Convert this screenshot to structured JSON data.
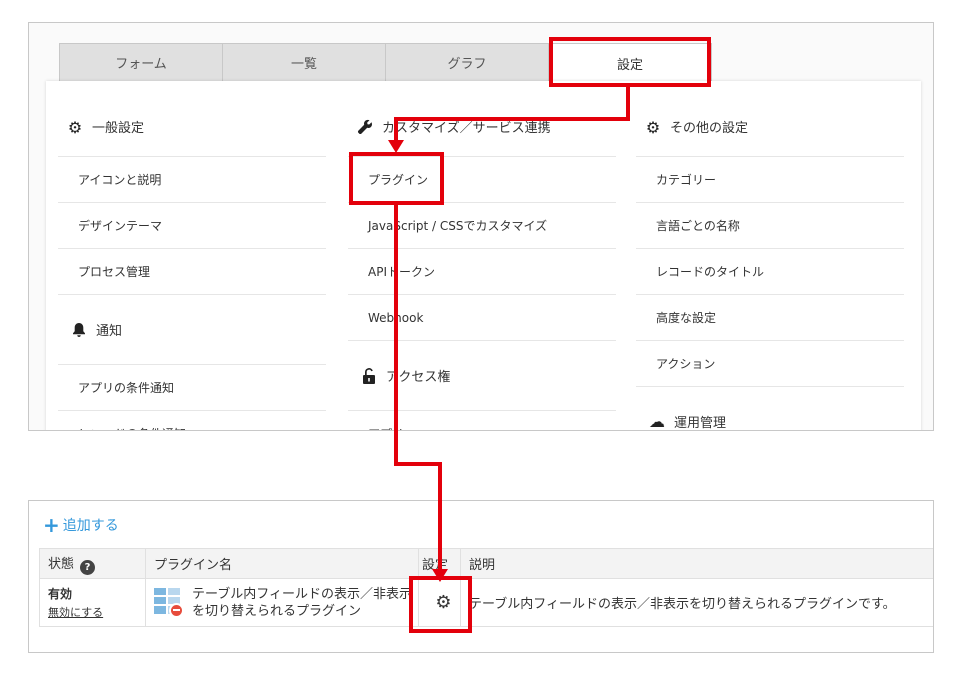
{
  "tabs": [
    {
      "label": "フォーム"
    },
    {
      "label": "一覧"
    },
    {
      "label": "グラフ"
    },
    {
      "label": "設定"
    }
  ],
  "columns": {
    "general": {
      "heading": "一般設定",
      "items": [
        "アイコンと説明",
        "デザインテーマ",
        "プロセス管理"
      ],
      "notify_heading": "通知",
      "notify_items": [
        "アプリの条件通知",
        "レコードの条件通知"
      ]
    },
    "customize": {
      "heading": "カスタマイズ／サービス連携",
      "items": [
        "プラグイン",
        "JavaScript / CSSでカスタマイズ",
        "APIトークン",
        "Webhook"
      ],
      "access_heading": "アクセス権",
      "access_items": [
        "アプリ"
      ]
    },
    "other": {
      "heading": "その他の設定",
      "items": [
        "カテゴリー",
        "言語ごとの名称",
        "レコードのタイトル",
        "高度な設定",
        "アクション"
      ],
      "ops_heading": "運用管理"
    }
  },
  "plugins": {
    "add_label": "追加する",
    "headers": {
      "status": "状態",
      "name": "プラグイン名",
      "settings": "設定",
      "description": "説明"
    },
    "rows": [
      {
        "status": "有効",
        "disable_link": "無効にする",
        "name_line1": "テーブル内フィールドの表示／非表示",
        "name_line2": "を切り替えられるプラグイン",
        "description": "テーブル内フィールドの表示／非表示を切り替えられるプラグインです。"
      }
    ]
  },
  "colors": {
    "annotation_red": "#e3000b",
    "link_blue": "#3498db"
  }
}
